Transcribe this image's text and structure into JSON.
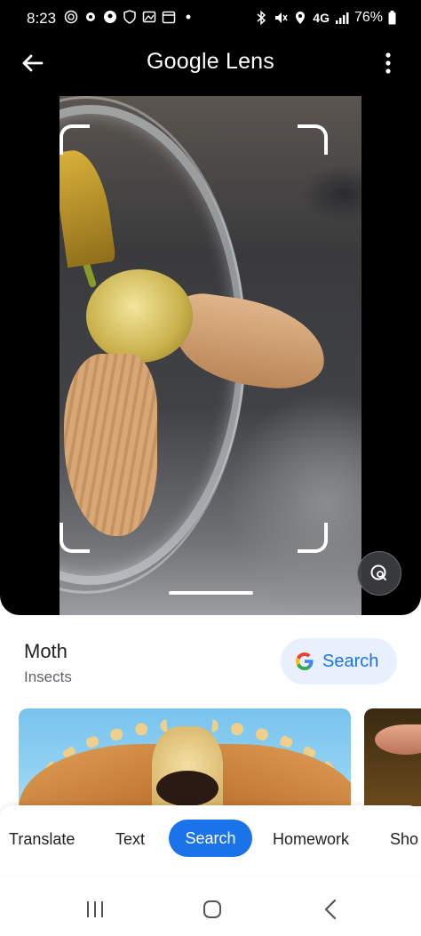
{
  "status_bar": {
    "time": "8:23",
    "network": "4G",
    "battery": "76%"
  },
  "header": {
    "title": "Google Lens"
  },
  "result": {
    "title": "Moth",
    "category": "Insects",
    "search_label": "Search"
  },
  "tabs": [
    {
      "label": "Translate"
    },
    {
      "label": "Text"
    },
    {
      "label": "Search",
      "active": true
    },
    {
      "label": "Homework"
    },
    {
      "label": "Sho"
    }
  ],
  "colors": {
    "accent": "#1a73e8",
    "chip_bg": "#e8f0fe"
  }
}
